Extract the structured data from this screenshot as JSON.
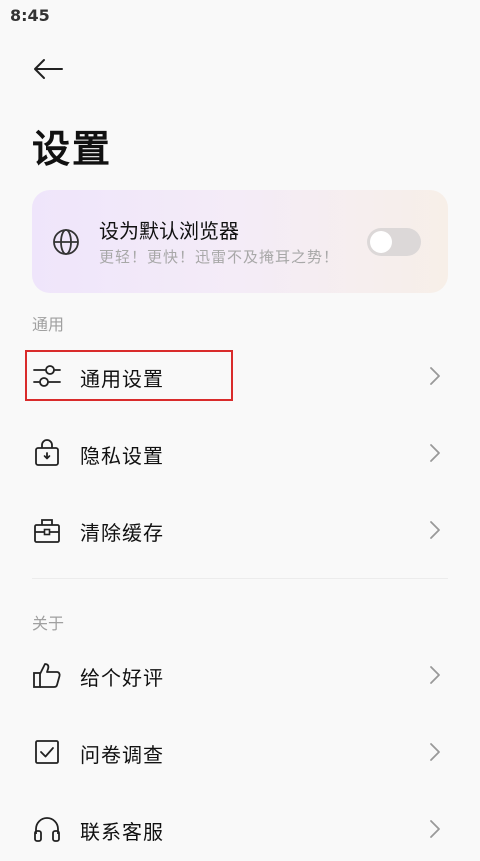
{
  "status_bar": {
    "time": "8:45"
  },
  "header": {
    "title": "设置"
  },
  "default_browser_card": {
    "title": "设为默认浏览器",
    "subtitle": "更轻！更快！迅雷不及掩耳之势！",
    "toggle_on": false
  },
  "sections": {
    "general": {
      "label": "通用",
      "items": [
        {
          "label": "通用设置",
          "icon": "sliders-icon"
        },
        {
          "label": "隐私设置",
          "icon": "lock-bag-icon"
        },
        {
          "label": "清除缓存",
          "icon": "toolbox-icon"
        }
      ]
    },
    "about": {
      "label": "关于",
      "items": [
        {
          "label": "给个好评",
          "icon": "thumbs-up-icon"
        },
        {
          "label": "问卷调查",
          "icon": "checkbox-icon"
        },
        {
          "label": "联系客服",
          "icon": "headset-icon"
        }
      ]
    }
  },
  "colors": {
    "highlight": "#d92b2b",
    "card_gradient_start": "#efe5fb",
    "card_gradient_end": "#f7efe8",
    "toggle_off": "#dcd8d8"
  }
}
